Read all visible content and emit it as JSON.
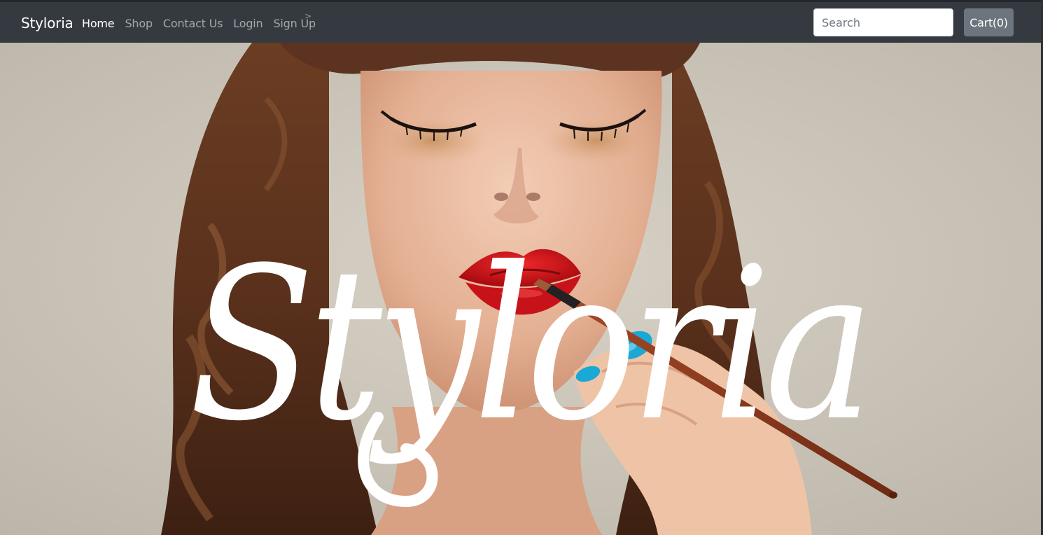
{
  "navbar": {
    "brand": "Styloria",
    "links": [
      {
        "label": "Home",
        "active": true
      },
      {
        "label": "Shop",
        "active": false
      },
      {
        "label": "Contact Us",
        "active": false
      },
      {
        "label": "Login",
        "active": false
      },
      {
        "label": "Sign Up",
        "active": false
      }
    ],
    "caret": ">",
    "search": {
      "placeholder": "Search",
      "value": ""
    },
    "cart_label": "Cart(0)"
  },
  "hero": {
    "logo_text": "Styloria",
    "image": "woman-applying-red-lipstick-photo"
  },
  "colors": {
    "navbar_bg": "#343a40",
    "cart_button_bg": "#6c757d",
    "lipstick_red": "#d4141a",
    "nail_blue": "#19a9d6"
  }
}
